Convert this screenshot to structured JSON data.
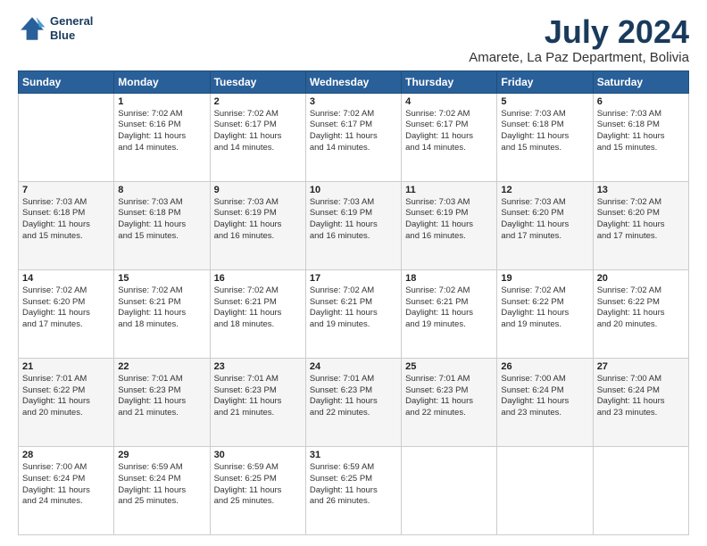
{
  "logo": {
    "line1": "General",
    "line2": "Blue"
  },
  "title": "July 2024",
  "location": "Amarete, La Paz Department, Bolivia",
  "header_days": [
    "Sunday",
    "Monday",
    "Tuesday",
    "Wednesday",
    "Thursday",
    "Friday",
    "Saturday"
  ],
  "weeks": [
    [
      {
        "day": "",
        "info": ""
      },
      {
        "day": "1",
        "info": "Sunrise: 7:02 AM\nSunset: 6:16 PM\nDaylight: 11 hours\nand 14 minutes."
      },
      {
        "day": "2",
        "info": "Sunrise: 7:02 AM\nSunset: 6:17 PM\nDaylight: 11 hours\nand 14 minutes."
      },
      {
        "day": "3",
        "info": "Sunrise: 7:02 AM\nSunset: 6:17 PM\nDaylight: 11 hours\nand 14 minutes."
      },
      {
        "day": "4",
        "info": "Sunrise: 7:02 AM\nSunset: 6:17 PM\nDaylight: 11 hours\nand 14 minutes."
      },
      {
        "day": "5",
        "info": "Sunrise: 7:03 AM\nSunset: 6:18 PM\nDaylight: 11 hours\nand 15 minutes."
      },
      {
        "day": "6",
        "info": "Sunrise: 7:03 AM\nSunset: 6:18 PM\nDaylight: 11 hours\nand 15 minutes."
      }
    ],
    [
      {
        "day": "7",
        "info": "Sunrise: 7:03 AM\nSunset: 6:18 PM\nDaylight: 11 hours\nand 15 minutes."
      },
      {
        "day": "8",
        "info": "Sunrise: 7:03 AM\nSunset: 6:18 PM\nDaylight: 11 hours\nand 15 minutes."
      },
      {
        "day": "9",
        "info": "Sunrise: 7:03 AM\nSunset: 6:19 PM\nDaylight: 11 hours\nand 16 minutes."
      },
      {
        "day": "10",
        "info": "Sunrise: 7:03 AM\nSunset: 6:19 PM\nDaylight: 11 hours\nand 16 minutes."
      },
      {
        "day": "11",
        "info": "Sunrise: 7:03 AM\nSunset: 6:19 PM\nDaylight: 11 hours\nand 16 minutes."
      },
      {
        "day": "12",
        "info": "Sunrise: 7:03 AM\nSunset: 6:20 PM\nDaylight: 11 hours\nand 17 minutes."
      },
      {
        "day": "13",
        "info": "Sunrise: 7:02 AM\nSunset: 6:20 PM\nDaylight: 11 hours\nand 17 minutes."
      }
    ],
    [
      {
        "day": "14",
        "info": "Sunrise: 7:02 AM\nSunset: 6:20 PM\nDaylight: 11 hours\nand 17 minutes."
      },
      {
        "day": "15",
        "info": "Sunrise: 7:02 AM\nSunset: 6:21 PM\nDaylight: 11 hours\nand 18 minutes."
      },
      {
        "day": "16",
        "info": "Sunrise: 7:02 AM\nSunset: 6:21 PM\nDaylight: 11 hours\nand 18 minutes."
      },
      {
        "day": "17",
        "info": "Sunrise: 7:02 AM\nSunset: 6:21 PM\nDaylight: 11 hours\nand 19 minutes."
      },
      {
        "day": "18",
        "info": "Sunrise: 7:02 AM\nSunset: 6:21 PM\nDaylight: 11 hours\nand 19 minutes."
      },
      {
        "day": "19",
        "info": "Sunrise: 7:02 AM\nSunset: 6:22 PM\nDaylight: 11 hours\nand 19 minutes."
      },
      {
        "day": "20",
        "info": "Sunrise: 7:02 AM\nSunset: 6:22 PM\nDaylight: 11 hours\nand 20 minutes."
      }
    ],
    [
      {
        "day": "21",
        "info": "Sunrise: 7:01 AM\nSunset: 6:22 PM\nDaylight: 11 hours\nand 20 minutes."
      },
      {
        "day": "22",
        "info": "Sunrise: 7:01 AM\nSunset: 6:23 PM\nDaylight: 11 hours\nand 21 minutes."
      },
      {
        "day": "23",
        "info": "Sunrise: 7:01 AM\nSunset: 6:23 PM\nDaylight: 11 hours\nand 21 minutes."
      },
      {
        "day": "24",
        "info": "Sunrise: 7:01 AM\nSunset: 6:23 PM\nDaylight: 11 hours\nand 22 minutes."
      },
      {
        "day": "25",
        "info": "Sunrise: 7:01 AM\nSunset: 6:23 PM\nDaylight: 11 hours\nand 22 minutes."
      },
      {
        "day": "26",
        "info": "Sunrise: 7:00 AM\nSunset: 6:24 PM\nDaylight: 11 hours\nand 23 minutes."
      },
      {
        "day": "27",
        "info": "Sunrise: 7:00 AM\nSunset: 6:24 PM\nDaylight: 11 hours\nand 23 minutes."
      }
    ],
    [
      {
        "day": "28",
        "info": "Sunrise: 7:00 AM\nSunset: 6:24 PM\nDaylight: 11 hours\nand 24 minutes."
      },
      {
        "day": "29",
        "info": "Sunrise: 6:59 AM\nSunset: 6:24 PM\nDaylight: 11 hours\nand 25 minutes."
      },
      {
        "day": "30",
        "info": "Sunrise: 6:59 AM\nSunset: 6:25 PM\nDaylight: 11 hours\nand 25 minutes."
      },
      {
        "day": "31",
        "info": "Sunrise: 6:59 AM\nSunset: 6:25 PM\nDaylight: 11 hours\nand 26 minutes."
      },
      {
        "day": "",
        "info": ""
      },
      {
        "day": "",
        "info": ""
      },
      {
        "day": "",
        "info": ""
      }
    ]
  ]
}
